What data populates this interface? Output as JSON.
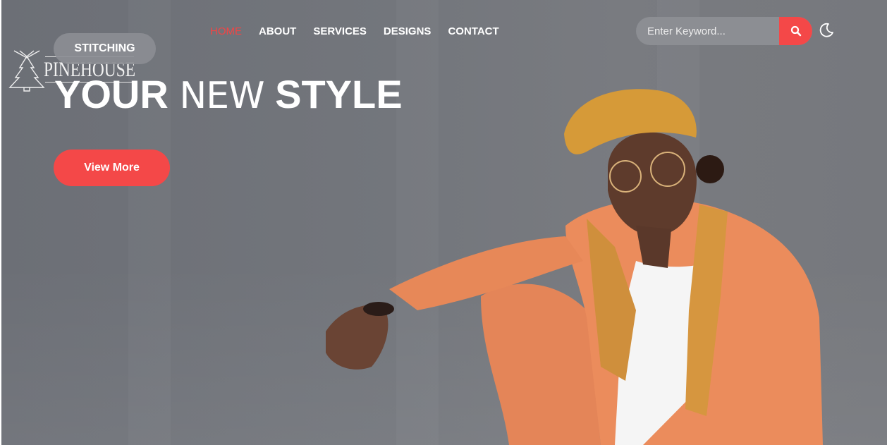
{
  "brand": {
    "logo_text": "PINEHOUSE",
    "tag_label": "STITCHING"
  },
  "nav": {
    "items": [
      {
        "label": "HOME",
        "active": true
      },
      {
        "label": "ABOUT",
        "active": false
      },
      {
        "label": "SERVICES",
        "active": false
      },
      {
        "label": "DESIGNS",
        "active": false
      },
      {
        "label": "CONTACT",
        "active": false
      }
    ]
  },
  "search": {
    "placeholder": "Enter Keyword...",
    "button_icon": "search-icon"
  },
  "theme_toggle": {
    "icon": "moon-icon"
  },
  "hero": {
    "headline_part1": "YOUR",
    "headline_part2": "NEW",
    "headline_part3": "STYLE",
    "cta_label": "View More",
    "image": "hero-photo-woman-in-orange-suit"
  },
  "colors": {
    "accent": "#f44848",
    "overlay": "#72757b",
    "suit": "#e8875a",
    "cap": "#d99a3a"
  }
}
